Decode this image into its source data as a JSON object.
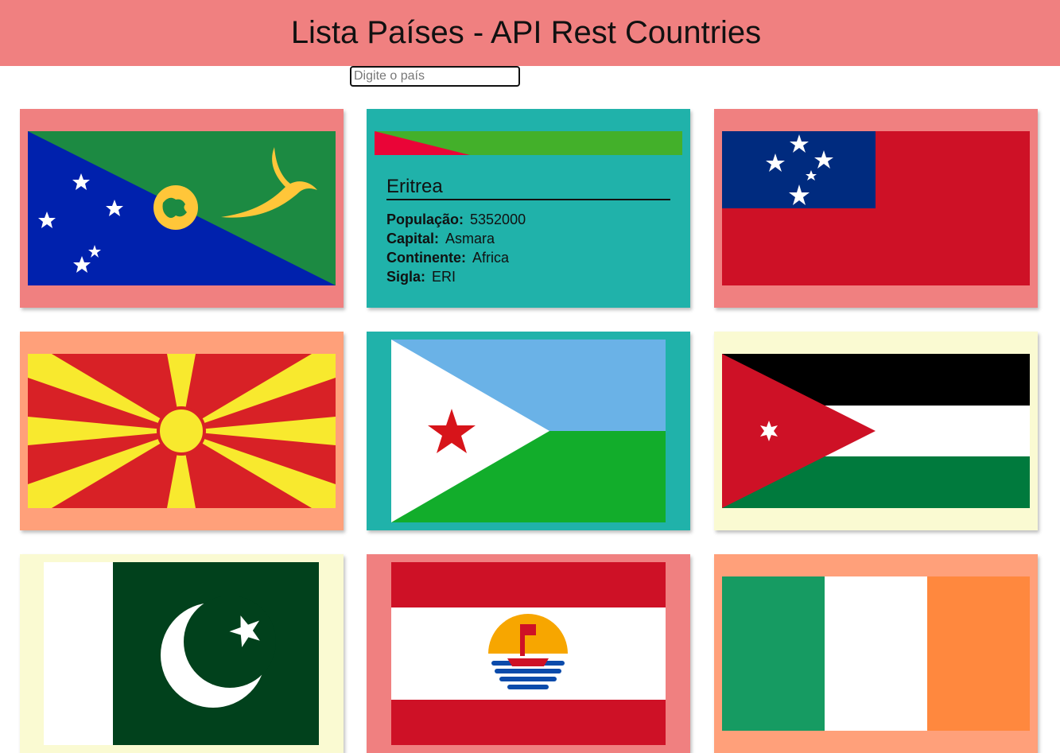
{
  "header": {
    "title": "Lista Países - API Rest Countries"
  },
  "search": {
    "placeholder": "Digite o país"
  },
  "countries": [
    {
      "flag": "christmas-island-flag",
      "bg": "#f08080"
    },
    {
      "flag": "eritrea-flag",
      "bg": "#20b2aa",
      "name": "Eritrea",
      "fields": [
        {
          "label": "População:",
          "value": "5352000"
        },
        {
          "label": "Capital:",
          "value": "Asmara"
        },
        {
          "label": "Continente:",
          "value": "Africa"
        },
        {
          "label": "Sigla:",
          "value": "ERI"
        }
      ]
    },
    {
      "flag": "samoa-flag",
      "bg": "#f08080"
    },
    {
      "flag": "north-macedonia-flag",
      "bg": "#ffa07a"
    },
    {
      "flag": "djibouti-flag",
      "bg": "#20b2aa"
    },
    {
      "flag": "jordan-flag",
      "bg": "#fafad2"
    },
    {
      "flag": "pakistan-flag",
      "bg": "#fafad2"
    },
    {
      "flag": "french-polynesia-flag",
      "bg": "#f08080"
    },
    {
      "flag": "ireland-flag",
      "bg": "#ffa07a"
    }
  ]
}
